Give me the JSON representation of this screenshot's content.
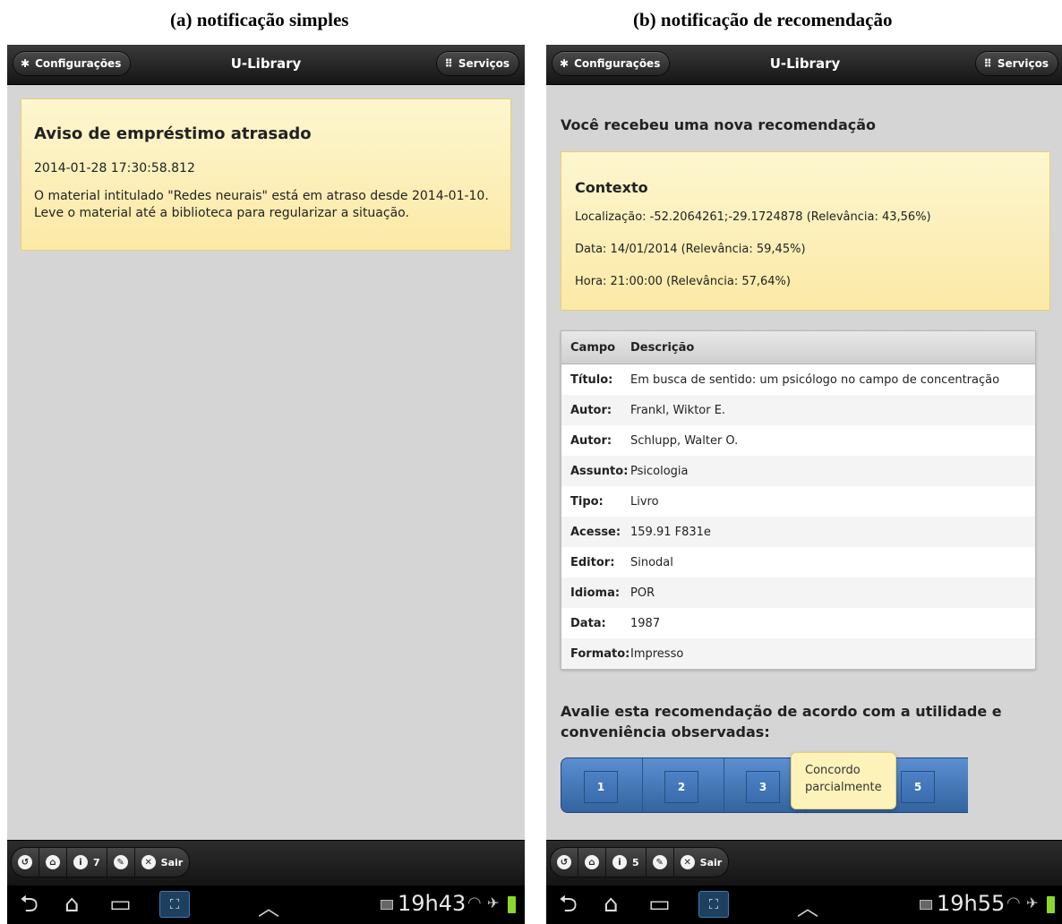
{
  "captions": {
    "a": "(a) notificação simples",
    "b": "(b) notificação de recomendação"
  },
  "header": {
    "settings_label": "Configurações",
    "title": "U-Library",
    "services_label": "Serviços",
    "settings_icon": "gear-icon",
    "services_icon": "grid-icon"
  },
  "screen_a": {
    "notice": {
      "title": "Aviso de empréstimo atrasado",
      "timestamp": "2014-01-28 17:30:58.812",
      "message": "O material intitulado \"Redes neurais\" está em atraso desde 2014-01-10. Leve o material até a biblioteca para regularizar a situação."
    },
    "footer": {
      "info_count": "7",
      "exit_label": "Sair"
    },
    "status": {
      "time": "19h43"
    }
  },
  "screen_b": {
    "heading": "Você recebeu uma nova recomendação",
    "context": {
      "title": "Contexto",
      "location": "Localização: -52.2064261;-29.1724878 (Relevância: 43,56%)",
      "date": "Data: 14/01/2014 (Relevância: 59,45%)",
      "time": "Hora: 21:00:00 (Relevância: 57,64%)"
    },
    "table": {
      "headers": [
        "Campo",
        "Descrição"
      ],
      "rows": [
        [
          "Título:",
          "Em busca de sentido: um psicólogo no campo de concentração"
        ],
        [
          "Autor:",
          "Frankl, Wiktor E."
        ],
        [
          "Autor:",
          "Schlupp, Walter O."
        ],
        [
          "Assunto:",
          "Psicologia"
        ],
        [
          "Tipo:",
          "Livro"
        ],
        [
          "Acesse:",
          "159.91 F831e"
        ],
        [
          "Editor:",
          "Sinodal"
        ],
        [
          "Idioma:",
          "POR"
        ],
        [
          "Data:",
          "1987"
        ],
        [
          "Formato:",
          "Impresso"
        ]
      ]
    },
    "rating": {
      "question": "Avalie esta recomendação de acordo com a utilidade e conveniência observadas:",
      "options": [
        "1",
        "2",
        "3",
        "5"
      ],
      "tooltip": "Concordo parcialmente"
    },
    "footer": {
      "info_count": "5",
      "exit_label": "Sair"
    },
    "status": {
      "time": "19h55"
    }
  },
  "colors": {
    "header_bg": "#1e1e1e",
    "notice_bg": "#fcefb8",
    "rating_blue": "#3f72b5",
    "battery": "#8cd630"
  }
}
